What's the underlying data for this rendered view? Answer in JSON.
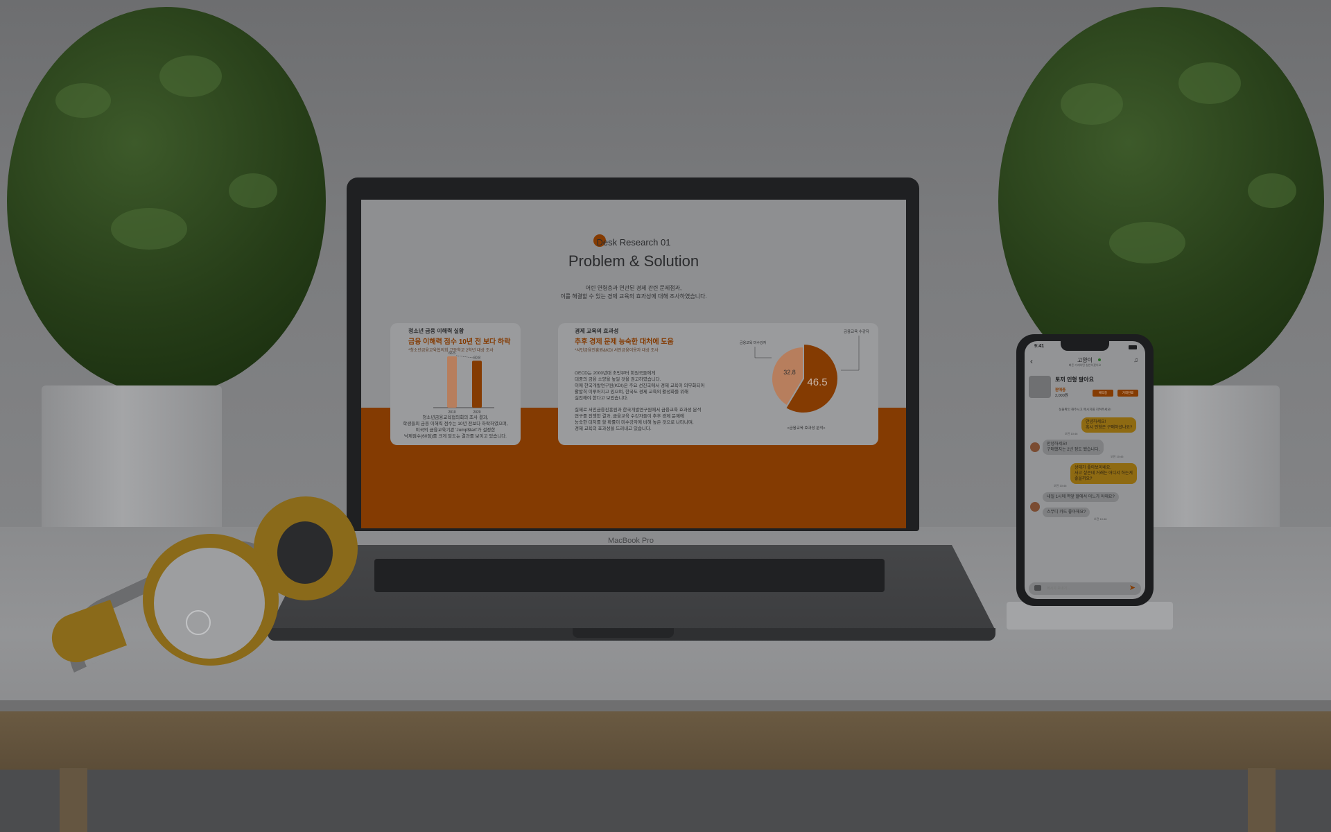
{
  "laptop": {
    "brand": "MacBook Pro",
    "slide": {
      "eyebrow": "Desk Research 01",
      "title": "Problem & Solution",
      "intro_1": "어린 연령층과 연관된 경제 관련 문제점과,",
      "intro_2": "이를 해결할 수 있는 경제 교육의 효과성에 대해 조사하였습니다.",
      "left_card": {
        "kicker": "청소년 금융 이해력 실황",
        "headline": "금융 이해력 점수 10년 전 보다 하락",
        "source": "*청소년금융교육협의회 고등학교 2학년 대상 조사",
        "text_1": "청소년금융교육협의회의 조사 결과,",
        "text_2": "학생들의 금융 이해력 점수는 10년 전보다 하락하였으며,",
        "text_3": "미국의 금융교육기관 'Jump$tart'가 설정한",
        "text_4": "낙제점수(60점)를 크게 밑도는 결과를 보이고 있습니다."
      },
      "right_card": {
        "kicker": "경제 교육의 효과성",
        "headline": "추후 경제 문제 능숙한 대처에 도움",
        "source": "*서민금융진흥원&KDI 서민금융이용자 대상 조사",
        "p1_1": "OECD는 2000년대 초반부터 회원국들에게",
        "p1_2": "대중의 금융 소양을 높일 것을 권고하였습니다.",
        "p1_3": "이에 한국개발연구원(KDI)은 주요 선진국에서 경제 교육이 의무화되어",
        "p1_4": "활발히 이루어지고 있으며, 한국도 경제 교육의 활성화를 위해",
        "p1_5": "실천해야 한다고 보았습니다.",
        "p2_1": "실제로 서민금융진흥원과 한국개발연구원에서 금융교육 효과성 분석",
        "p2_2": "연구를 진행한 결과, 금융교육 수강자들이 추후 경제 문제에",
        "p2_3": "능숙한 대처를 할 확률이 미수강자에 비해 높은 것으로 나타나며,",
        "p2_4": "경제 교육의 효과성을 드러내고 있습니다."
      }
    }
  },
  "chart_data": [
    {
      "type": "bar",
      "categories": [
        "2010",
        "2020"
      ],
      "values": [
        66.5,
        60.8
      ],
      "ylim": [
        0,
        70
      ],
      "colors": [
        "#b77e5d",
        "#843b02"
      ]
    },
    {
      "type": "pie",
      "labels": [
        "금융교육 미수강자",
        "금융교육 수강자"
      ],
      "values": [
        32.8,
        46.5
      ],
      "colors": [
        "#b77e5d",
        "#843b02"
      ],
      "caption": "<금융교육 효과성 분석>"
    }
  ],
  "phone": {
    "status_time": "9:41",
    "chat_title": "고양이",
    "chat_subtitle": "빠른 거래하면 칭찬하겠어요",
    "product_title": "토끼 인형 팔아요",
    "product_status": "판매중",
    "product_price": "2,000원",
    "btn_reserve": "예약중",
    "btn_complete": "거래완료",
    "notice": "실물확인 해주시고 메시지를 지켜주세요!",
    "messages": [
      {
        "from": "me",
        "text_1": "안녕하세요!",
        "text_2": "혹시 인형은 구매하셨나요?",
        "time": "오전 10:46"
      },
      {
        "from": "them",
        "text_1": "안녕하세요!",
        "text_2": "구매했지는 2년 정도 됐습니다.",
        "time": "오전 10:46"
      },
      {
        "from": "me",
        "text_1": "상태가 좋아보이네요.",
        "text_2": "사고 싶은데 거래는 어디서 하는게",
        "text_3": "좋을까요?",
        "time": "오전 10:46"
      },
      {
        "from": "them",
        "text_1": "내일 1시에 역앞 할에서 어느가 어때요?",
        "time": ""
      },
      {
        "from": "them",
        "text_1": "스무디 카드 좋아해요?",
        "time": "오전 10:46"
      }
    ],
    "input_placeholder": "메시지 보내기..."
  },
  "colors": {
    "accent": "#843b02",
    "accent_light": "#b77e5d",
    "chat_me": "#8e6a12"
  }
}
